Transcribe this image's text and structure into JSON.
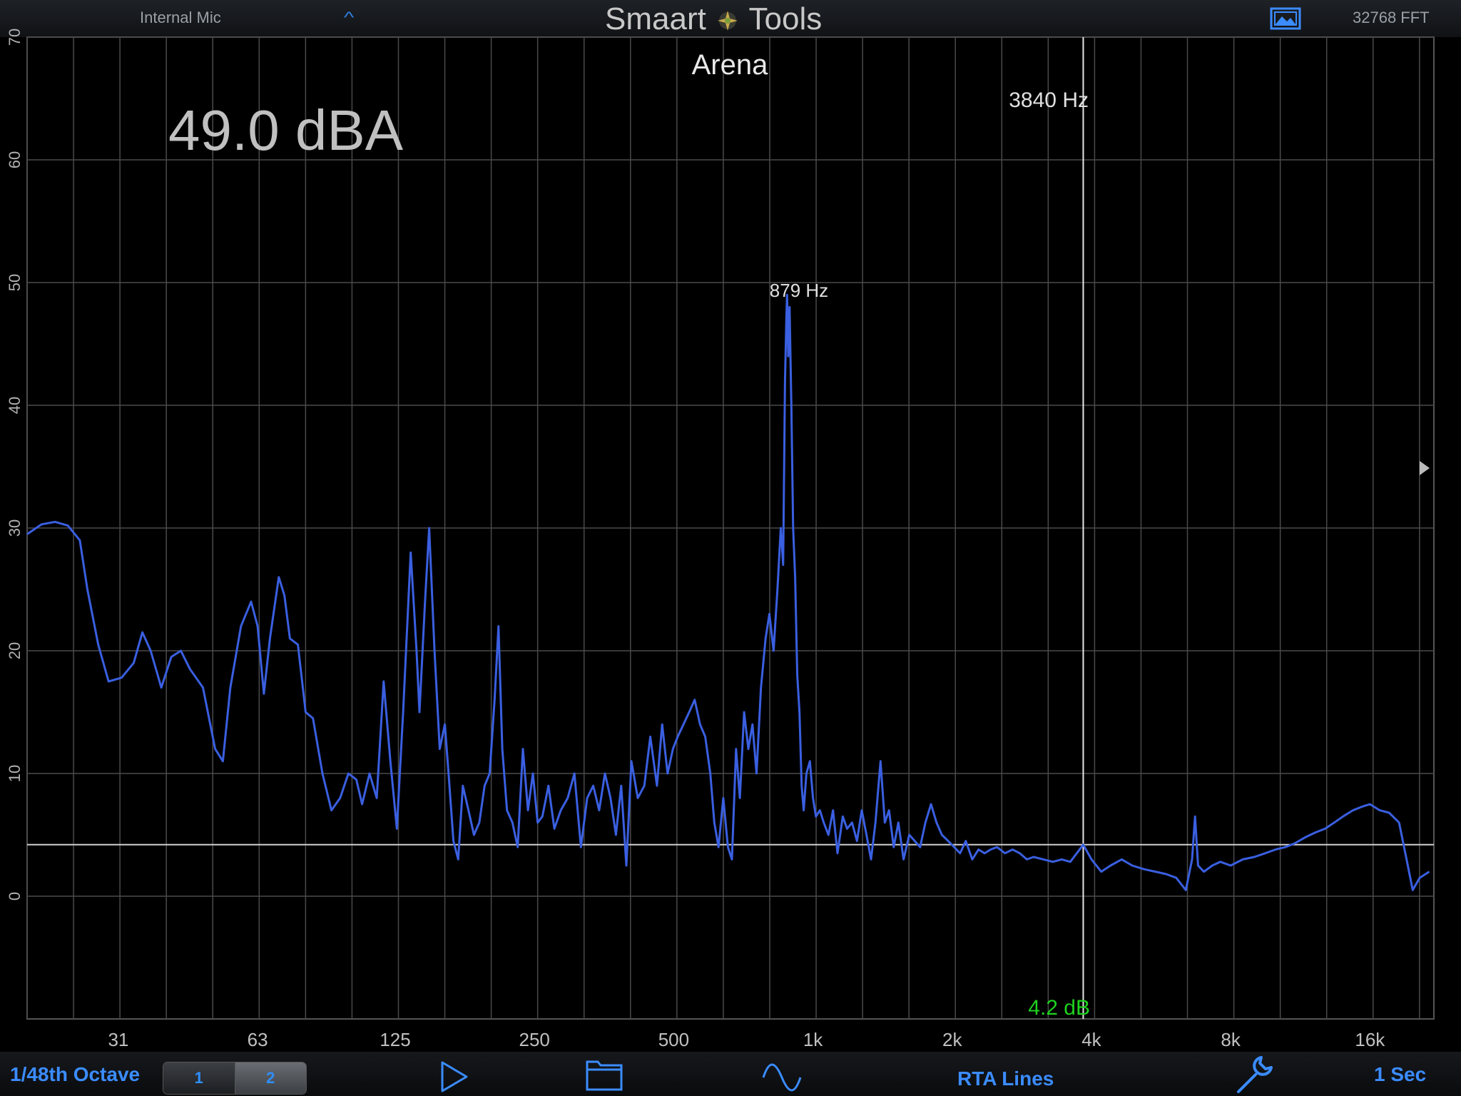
{
  "header": {
    "input_source": "Internal Mic",
    "input_chevron": "^",
    "title_left": "Smaart",
    "title_right": "Tools",
    "fft_size": "32768 FFT",
    "screenshot_icon": "image-icon"
  },
  "overlay": {
    "spl_readout": "49.0 dBA",
    "preset_name": "Arena",
    "cursor_freq": "3840 Hz",
    "cursor_level": "4.2 dB",
    "peak_label": "879 Hz"
  },
  "colors": {
    "trace": "#3a5fe0",
    "cursor": "#e6e6e6",
    "cursor_level": "#1ed21e",
    "accent": "#3b8cff"
  },
  "footer": {
    "resolution": "1/48th Octave",
    "view_1": "1",
    "view_2": "2",
    "play_icon": "play-icon",
    "folder_icon": "folder-icon",
    "wave_icon": "sine-wave-icon",
    "mode": "RTA Lines",
    "settings_icon": "wrench-icon",
    "avg_time": "1 Sec"
  },
  "chart_data": {
    "type": "line",
    "x_scale": "log",
    "xlim": [
      20,
      22000
    ],
    "ylim": [
      -10,
      70
    ],
    "y_ticks": [
      0,
      10,
      20,
      30,
      40,
      50,
      60,
      70
    ],
    "x_tick_labels": [
      {
        "label": "31",
        "f": 31.5
      },
      {
        "label": "63",
        "f": 63
      },
      {
        "label": "125",
        "f": 125
      },
      {
        "label": "250",
        "f": 250
      },
      {
        "label": "500",
        "f": 500
      },
      {
        "label": "1k",
        "f": 1000
      },
      {
        "label": "2k",
        "f": 2000
      },
      {
        "label": "4k",
        "f": 4000
      },
      {
        "label": "8k",
        "f": 8000
      },
      {
        "label": "16k",
        "f": 16000
      }
    ],
    "grid": true,
    "cursor_frequency_hz": 3840,
    "cursor_level_db": 4.2,
    "series": [
      {
        "values_hz_db": [
          [
            20,
            29.5
          ],
          [
            21.5,
            30.3
          ],
          [
            23,
            30.5
          ],
          [
            24.5,
            30.2
          ],
          [
            26,
            29
          ],
          [
            27,
            25
          ],
          [
            28.5,
            20.5
          ],
          [
            30,
            17.5
          ],
          [
            32,
            17.8
          ],
          [
            34,
            19
          ],
          [
            35.5,
            21.5
          ],
          [
            37,
            20
          ],
          [
            39,
            17
          ],
          [
            41,
            19.5
          ],
          [
            43,
            20
          ],
          [
            45,
            18.5
          ],
          [
            48,
            17
          ],
          [
            51,
            12
          ],
          [
            53,
            11
          ],
          [
            55,
            17
          ],
          [
            58,
            22
          ],
          [
            61,
            24
          ],
          [
            63,
            22
          ],
          [
            65,
            16.5
          ],
          [
            67,
            21
          ],
          [
            70,
            26
          ],
          [
            72,
            24.5
          ],
          [
            74,
            21
          ],
          [
            77,
            20.5
          ],
          [
            80,
            15
          ],
          [
            83,
            14.5
          ],
          [
            87,
            10
          ],
          [
            91,
            7
          ],
          [
            95,
            8
          ],
          [
            99,
            10
          ],
          [
            103,
            9.5
          ],
          [
            106,
            7.5
          ],
          [
            110,
            10
          ],
          [
            114,
            8
          ],
          [
            118,
            17.5
          ],
          [
            122,
            11
          ],
          [
            126,
            5.5
          ],
          [
            130,
            15
          ],
          [
            135,
            28
          ],
          [
            139,
            20
          ],
          [
            141,
            15
          ],
          [
            145,
            24
          ],
          [
            148,
            30
          ],
          [
            152,
            20
          ],
          [
            156,
            12
          ],
          [
            160,
            14
          ],
          [
            163,
            10
          ],
          [
            167,
            4.5
          ],
          [
            171,
            3
          ],
          [
            175,
            9
          ],
          [
            180,
            7
          ],
          [
            185,
            5
          ],
          [
            190,
            6
          ],
          [
            195,
            9
          ],
          [
            200,
            10
          ],
          [
            205,
            16
          ],
          [
            209,
            22
          ],
          [
            213,
            12
          ],
          [
            218,
            7
          ],
          [
            224,
            6
          ],
          [
            230,
            4
          ],
          [
            236,
            12
          ],
          [
            242,
            7
          ],
          [
            248,
            10
          ],
          [
            254,
            6
          ],
          [
            260,
            6.5
          ],
          [
            268,
            9
          ],
          [
            276,
            5.5
          ],
          [
            285,
            7
          ],
          [
            295,
            8
          ],
          [
            305,
            10
          ],
          [
            315,
            4
          ],
          [
            325,
            8
          ],
          [
            335,
            9
          ],
          [
            345,
            7
          ],
          [
            355,
            10
          ],
          [
            365,
            8
          ],
          [
            375,
            5
          ],
          [
            385,
            9
          ],
          [
            395,
            2.5
          ],
          [
            405,
            11
          ],
          [
            418,
            8
          ],
          [
            432,
            9
          ],
          [
            445,
            13
          ],
          [
            460,
            9
          ],
          [
            472,
            14
          ],
          [
            485,
            10
          ],
          [
            498,
            12
          ],
          [
            510,
            13
          ],
          [
            525,
            14
          ],
          [
            540,
            15
          ],
          [
            555,
            16
          ],
          [
            570,
            14
          ],
          [
            585,
            13
          ],
          [
            600,
            10
          ],
          [
            612,
            6
          ],
          [
            625,
            4
          ],
          [
            640,
            8
          ],
          [
            655,
            4
          ],
          [
            668,
            3
          ],
          [
            682,
            12
          ],
          [
            695,
            8
          ],
          [
            710,
            15
          ],
          [
            725,
            12
          ],
          [
            740,
            14
          ],
          [
            755,
            10
          ],
          [
            772,
            17
          ],
          [
            790,
            21
          ],
          [
            805,
            23
          ],
          [
            822,
            20
          ],
          [
            838,
            25
          ],
          [
            852,
            30
          ],
          [
            862,
            27
          ],
          [
            870,
            42
          ],
          [
            876,
            47
          ],
          [
            879,
            49
          ],
          [
            884,
            44
          ],
          [
            890,
            48
          ],
          [
            898,
            40
          ],
          [
            906,
            30
          ],
          [
            915,
            26
          ],
          [
            925,
            18
          ],
          [
            935,
            15
          ],
          [
            945,
            9
          ],
          [
            955,
            7
          ],
          [
            968,
            10
          ],
          [
            985,
            11
          ],
          [
            1000,
            8
          ],
          [
            1015,
            6.5
          ],
          [
            1035,
            7
          ],
          [
            1055,
            6
          ],
          [
            1080,
            5
          ],
          [
            1105,
            7
          ],
          [
            1130,
            3.5
          ],
          [
            1160,
            6.5
          ],
          [
            1185,
            5.5
          ],
          [
            1215,
            6
          ],
          [
            1245,
            4.5
          ],
          [
            1275,
            7
          ],
          [
            1305,
            5
          ],
          [
            1335,
            3
          ],
          [
            1365,
            6
          ],
          [
            1400,
            11
          ],
          [
            1430,
            6
          ],
          [
            1460,
            7
          ],
          [
            1495,
            4
          ],
          [
            1530,
            6
          ],
          [
            1570,
            3
          ],
          [
            1615,
            5
          ],
          [
            1660,
            4.5
          ],
          [
            1705,
            4
          ],
          [
            1750,
            6
          ],
          [
            1800,
            7.5
          ],
          [
            1850,
            6
          ],
          [
            1900,
            5
          ],
          [
            1960,
            4.5
          ],
          [
            2020,
            4
          ],
          [
            2080,
            3.5
          ],
          [
            2140,
            4.5
          ],
          [
            2210,
            3
          ],
          [
            2280,
            3.8
          ],
          [
            2350,
            3.5
          ],
          [
            2420,
            3.8
          ],
          [
            2500,
            4
          ],
          [
            2600,
            3.5
          ],
          [
            2700,
            3.8
          ],
          [
            2800,
            3.5
          ],
          [
            2900,
            3
          ],
          [
            3000,
            3.2
          ],
          [
            3150,
            3
          ],
          [
            3300,
            2.8
          ],
          [
            3450,
            3
          ],
          [
            3600,
            2.8
          ],
          [
            3840,
            4.2
          ],
          [
            4000,
            3
          ],
          [
            4200,
            2
          ],
          [
            4400,
            2.5
          ],
          [
            4650,
            3
          ],
          [
            4900,
            2.5
          ],
          [
            5200,
            2.2
          ],
          [
            5500,
            2
          ],
          [
            5800,
            1.8
          ],
          [
            6100,
            1.5
          ],
          [
            6400,
            0.5
          ],
          [
            6600,
            3
          ],
          [
            6700,
            6.5
          ],
          [
            6800,
            2.5
          ],
          [
            7000,
            2
          ],
          [
            7300,
            2.5
          ],
          [
            7600,
            2.8
          ],
          [
            8000,
            2.5
          ],
          [
            8500,
            3
          ],
          [
            9000,
            3.2
          ],
          [
            9500,
            3.5
          ],
          [
            10000,
            3.8
          ],
          [
            10500,
            4
          ],
          [
            11000,
            4.3
          ],
          [
            11600,
            4.8
          ],
          [
            12200,
            5.2
          ],
          [
            12800,
            5.5
          ],
          [
            13400,
            6
          ],
          [
            14000,
            6.5
          ],
          [
            14700,
            7
          ],
          [
            15400,
            7.3
          ],
          [
            16000,
            7.5
          ],
          [
            16800,
            7
          ],
          [
            17600,
            6.8
          ],
          [
            18500,
            6
          ],
          [
            19200,
            3
          ],
          [
            19800,
            0.5
          ],
          [
            20500,
            1.5
          ],
          [
            21500,
            2
          ]
        ]
      }
    ]
  }
}
